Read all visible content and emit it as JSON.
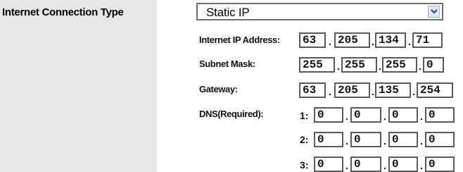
{
  "section": {
    "title": "Internet Connection Type"
  },
  "connection_type": {
    "selected": "Static IP"
  },
  "fields": {
    "ip_address": {
      "label": "Internet IP Address:",
      "octets": [
        "63",
        "205",
        "134",
        "71"
      ]
    },
    "subnet_mask": {
      "label": "Subnet Mask:",
      "octets": [
        "255",
        "255",
        "255",
        "0"
      ]
    },
    "gateway": {
      "label": "Gateway:",
      "octets": [
        "63",
        "205",
        "135",
        "254"
      ]
    },
    "dns": {
      "label": "DNS(Required):",
      "entries": [
        {
          "index": "1:",
          "octets": [
            "0",
            "0",
            "0",
            "0"
          ]
        },
        {
          "index": "2:",
          "octets": [
            "0",
            "0",
            "0",
            "0"
          ]
        },
        {
          "index": "3:",
          "octets": [
            "0",
            "0",
            "0",
            "0"
          ]
        }
      ]
    }
  },
  "separator": ".",
  "icons": {
    "dropdown": "chevron-down-icon"
  }
}
